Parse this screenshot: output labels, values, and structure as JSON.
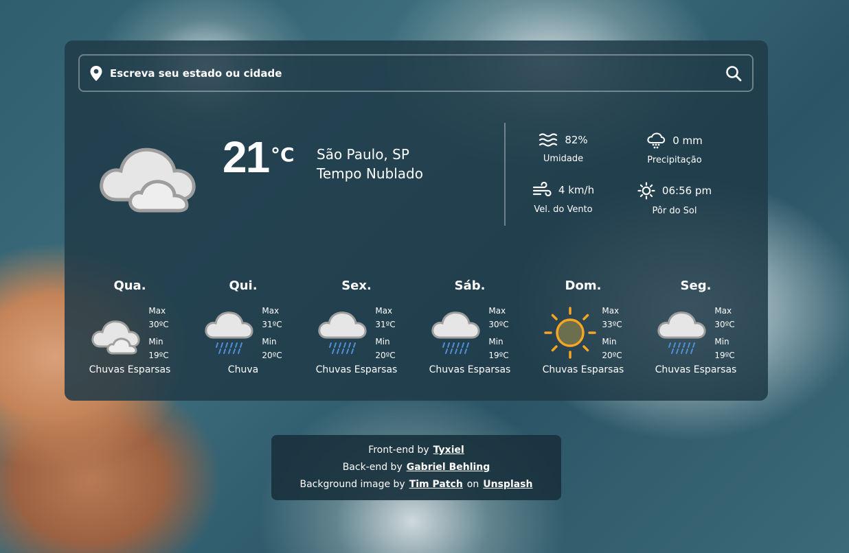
{
  "search": {
    "placeholder": "Escreva seu estado ou cidade"
  },
  "current": {
    "temperature": "21",
    "unit": "°C",
    "location": "São Paulo, SP",
    "condition": "Tempo Nublado",
    "icon": "cloudy-icon"
  },
  "stats": {
    "humidity": {
      "value": "82%",
      "label": "Umidade",
      "icon": "waves-icon"
    },
    "precipitation": {
      "value": "0 mm",
      "label": "Precipitação",
      "icon": "rain-cloud-icon"
    },
    "wind": {
      "value": "4 km/h",
      "label": "Vel. do Vento",
      "icon": "wind-icon"
    },
    "sunset": {
      "value": "06:56 pm",
      "label": "Pôr do Sol",
      "icon": "sun-icon"
    }
  },
  "forecast": [
    {
      "day": "Qua.",
      "max_label": "Max",
      "max": "30ºC",
      "min_label": "Min",
      "min": "19ºC",
      "desc": "Chuvas Esparsas",
      "icon": "cloudy-icon"
    },
    {
      "day": "Qui.",
      "max_label": "Max",
      "max": "31ºC",
      "min_label": "Min",
      "min": "20ºC",
      "desc": "Chuva",
      "icon": "rain-icon"
    },
    {
      "day": "Sex.",
      "max_label": "Max",
      "max": "31ºC",
      "min_label": "Min",
      "min": "20ºC",
      "desc": "Chuvas Esparsas",
      "icon": "rain-icon"
    },
    {
      "day": "Sáb.",
      "max_label": "Max",
      "max": "30ºC",
      "min_label": "Min",
      "min": "19ºC",
      "desc": "Chuvas Esparsas",
      "icon": "rain-icon"
    },
    {
      "day": "Dom.",
      "max_label": "Max",
      "max": "33ºC",
      "min_label": "Min",
      "min": "20ºC",
      "desc": "Chuvas Esparsas",
      "icon": "sun-icon"
    },
    {
      "day": "Seg.",
      "max_label": "Max",
      "max": "30ºC",
      "min_label": "Min",
      "min": "19ºC",
      "desc": "Chuvas Esparsas",
      "icon": "rain-icon"
    }
  ],
  "credits": {
    "frontend_prefix": "Front-end by",
    "frontend_name": "Tyxiel",
    "backend_prefix": "Back-end by",
    "backend_name": "Gabriel Behling",
    "bg_prefix": "Background image by",
    "bg_author": "Tim Patch",
    "bg_on": "on",
    "bg_site": "Unsplash"
  },
  "colors": {
    "card": "#203a48",
    "sun": "#f5a623",
    "rain": "#4f8fd6"
  }
}
